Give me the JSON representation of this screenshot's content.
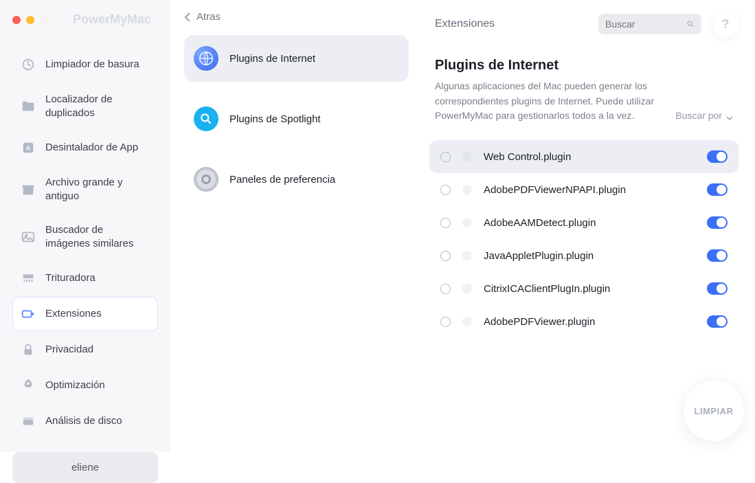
{
  "app_title": "PowerMyMac",
  "back_label": "Atras",
  "breadcrumb": "Extensiones",
  "search_placeholder": "Buscar",
  "help_label": "?",
  "user_name": "eliene",
  "sidebar": {
    "items": [
      {
        "label": "Limpiador de basura"
      },
      {
        "label": "Localizador de duplicados"
      },
      {
        "label": "Desintalador de App"
      },
      {
        "label": "Archivo grande y antiguo"
      },
      {
        "label": "Buscador de imágenes similares"
      },
      {
        "label": "Trituradora"
      },
      {
        "label": "Extensiones"
      },
      {
        "label": "Privacidad"
      },
      {
        "label": "Optimización"
      },
      {
        "label": "Análisis de disco"
      }
    ]
  },
  "categories": [
    {
      "label": "Plugins de Internet"
    },
    {
      "label": "Plugins de Spotlight"
    },
    {
      "label": "Paneles de preferencia"
    }
  ],
  "content": {
    "title": "Plugins de Internet",
    "description": "Algunas aplicaciones del Mac pueden generar los correspondientes plugins de Internet. Puede utilizar PowerMyMac para gestionarlos todos a la vez.",
    "sort_label": "Buscar por"
  },
  "plugins": [
    {
      "name": "Web Control.plugin"
    },
    {
      "name": "AdobePDFViewerNPAPI.plugin"
    },
    {
      "name": "AdobeAAMDetect.plugin"
    },
    {
      "name": "JavaAppletPlugin.plugin"
    },
    {
      "name": "CitrixICAClientPlugIn.plugin"
    },
    {
      "name": "AdobePDFViewer.plugin"
    }
  ],
  "clean_label": "LIMPIAR"
}
